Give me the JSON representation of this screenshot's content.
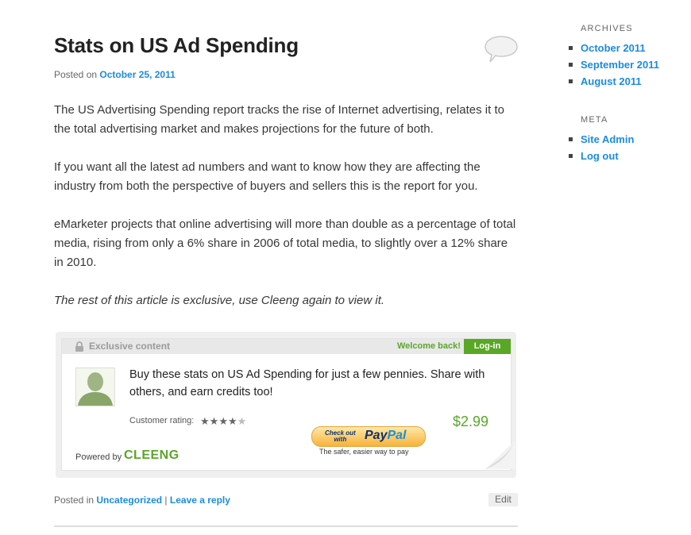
{
  "post": {
    "title": "Stats on US Ad Spending",
    "posted_on_prefix": "Posted on",
    "date": "October 25, 2011",
    "paragraphs": [
      "The US Advertising Spending report tracks the rise of Internet advertising, relates it to the total advertising market and makes projections for the future of both.",
      "If you want all the latest ad numbers and want to know how they are affecting the industry from both the perspective of buyers and sellers this is the report for you.",
      "eMarketer projects that online advertising will more than double as a percentage of total media, rising from only a 6% share in 2006 of total media, to slightly over a 12% share in 2010.",
      "The rest of this article is exclusive, use Cleeng again to view it."
    ],
    "comment_icon": "speech-bubble-icon"
  },
  "cleeng": {
    "header_label": "Exclusive content",
    "lock_icon": "lock-icon",
    "welcome": "Welcome back!",
    "login_label": "Log-in",
    "offer_text": "Buy these stats on US Ad Spending for just a few pennies. Share with others, and earn credits too!",
    "rating_label": "Customer rating:",
    "rating": 4,
    "rating_max": 5,
    "price": "$2.99",
    "paypal": {
      "checkout_line1": "Check out",
      "checkout_line2": "with",
      "pay": "Pay",
      "pal": "Pal",
      "tagline": "The safer, easier way to pay"
    },
    "powered_by": "Powered by",
    "brand": "CLEENG",
    "accent_color": "#5aa62a"
  },
  "footer": {
    "posted_in": "Posted in",
    "category": "Uncategorized",
    "divider": "|",
    "reply": "Leave a reply",
    "edit": "Edit"
  },
  "sidebar": {
    "archives_title": "ARCHIVES",
    "archives": [
      "October 2011",
      "September 2011",
      "August 2011"
    ],
    "meta_title": "META",
    "meta": [
      "Site Admin",
      "Log out"
    ]
  },
  "colors": {
    "link": "#1b8be0",
    "text": "#373737"
  }
}
